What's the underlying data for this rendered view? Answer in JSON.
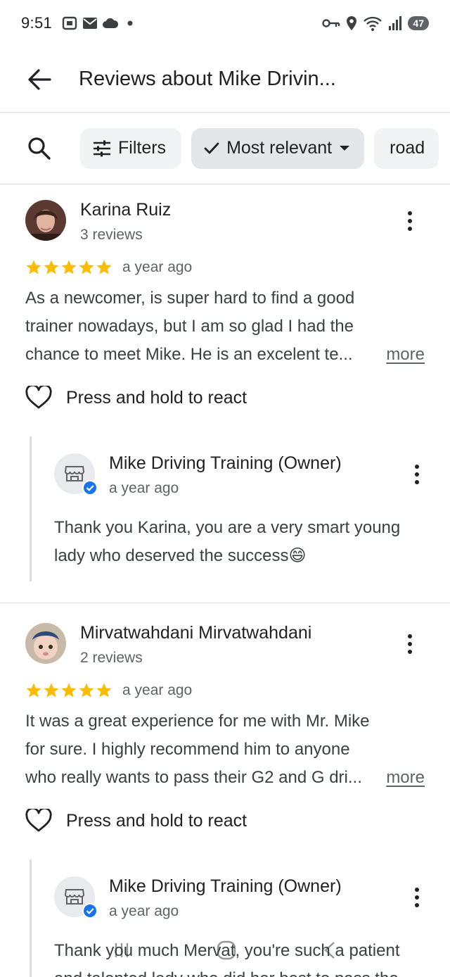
{
  "status_bar": {
    "time": "9:51",
    "battery": "47",
    "icons": [
      "screenshot-icon",
      "mail-icon",
      "cloud-icon",
      "dot-icon",
      "vpn-key-icon",
      "location-icon",
      "wifi-icon",
      "signal-icon",
      "battery-icon"
    ]
  },
  "app_bar": {
    "title": "Reviews about Mike Drivin..."
  },
  "chips": {
    "filters": "Filters",
    "sort": "Most relevant",
    "road": "road"
  },
  "reviews": [
    {
      "name": "Karina Ruiz",
      "count": "3 reviews",
      "rating": 5,
      "date": "a year ago",
      "text_lines": [
        "As a newcomer, is super hard to find a good",
        "trainer nowadays, but I am so glad I had the",
        "chance to meet Mike. He is an excelent te..."
      ],
      "more": "more",
      "react": "Press and hold to react",
      "reply": {
        "owner": "Mike Driving Training (Owner)",
        "date": "a year ago",
        "text_lines": [
          "Thank you Karina, you are a very smart young",
          "lady who deserved the success😄"
        ]
      }
    },
    {
      "name": "Mirvatwahdani Mirvatwahdani",
      "count": "2 reviews",
      "rating": 5,
      "date": "a year ago",
      "text_lines": [
        "It was a great experience for me with Mr. Mike",
        "for sure. I highly recommend him to anyone",
        "who really wants to pass their G2 and G dri..."
      ],
      "more": "more",
      "react": "Press and hold to react",
      "reply": {
        "owner": "Mike Driving Training (Owner)",
        "date": "a year ago",
        "text_lines": [
          "Thank you much Mervat, you're such a patient",
          "and talented lady who did her best to pass the"
        ]
      }
    }
  ],
  "colors": {
    "star": "#fbbc04",
    "verified": "#1a73e8",
    "chip_selected": "#e3e7ea",
    "chip": "#f1f3f4"
  }
}
